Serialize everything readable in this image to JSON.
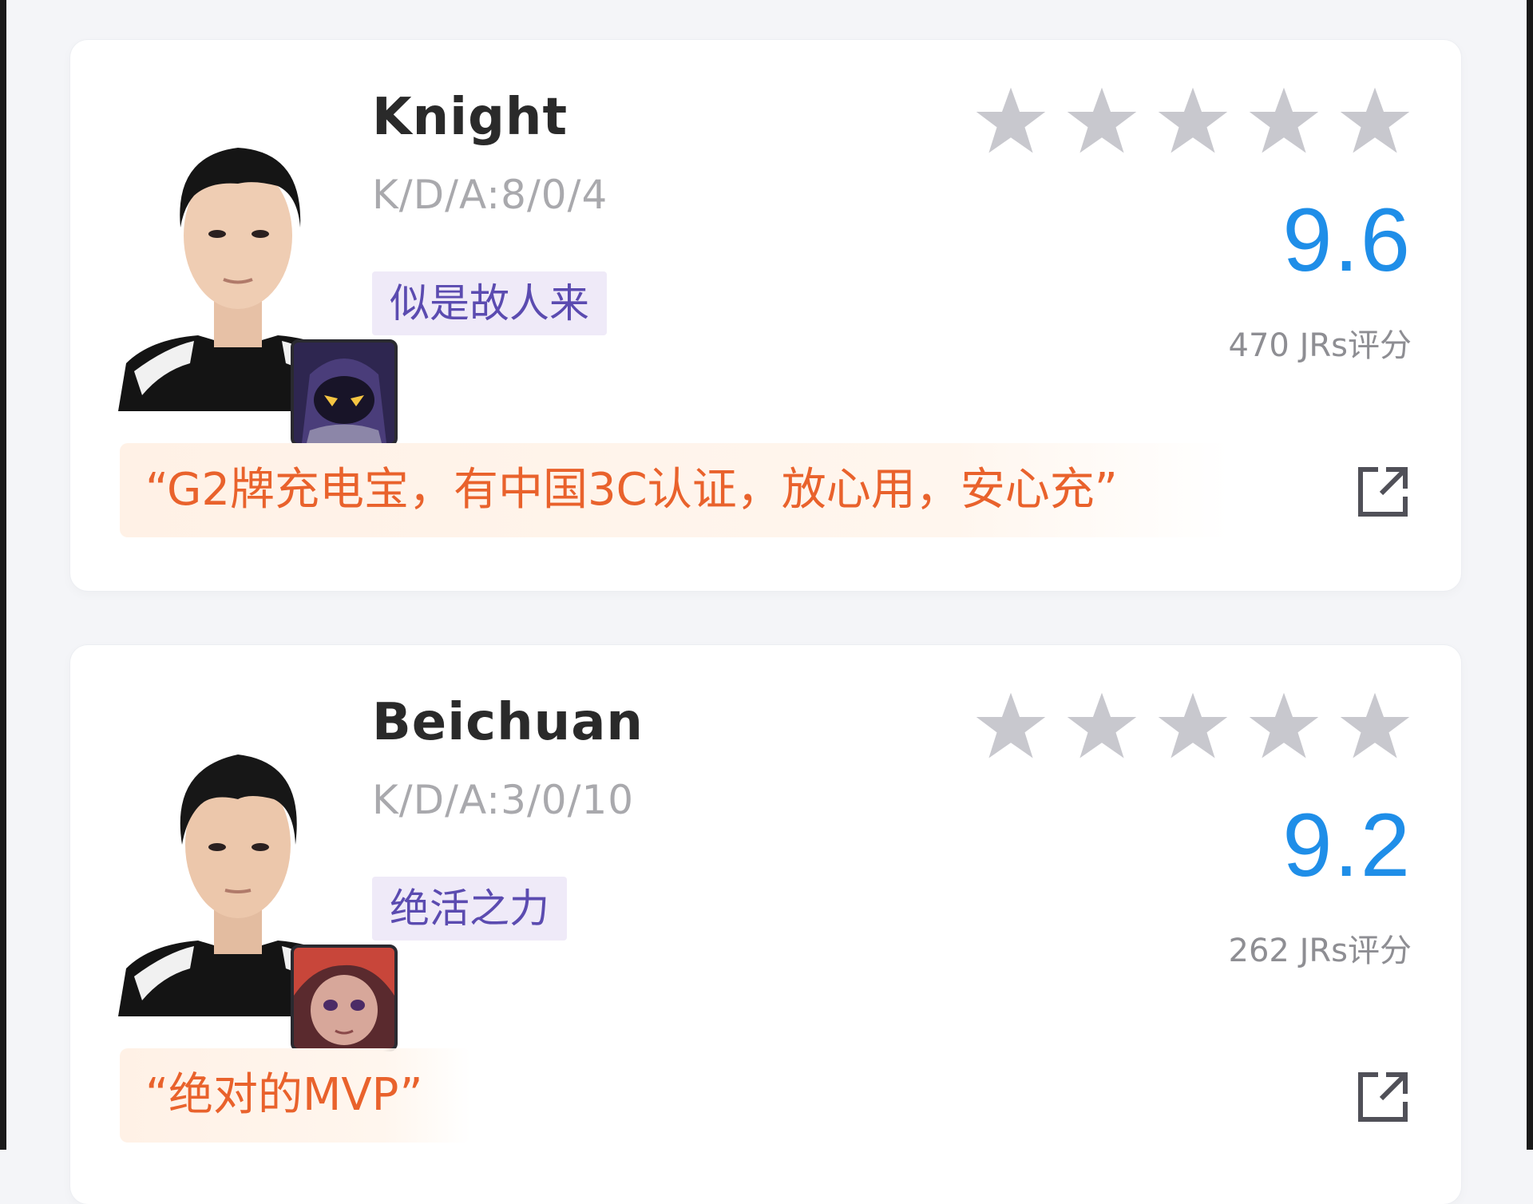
{
  "colors": {
    "score_blue": "#1f8ee8",
    "quote_orange": "#e9622c",
    "tag_purple": "#5b4bb0",
    "star_grey": "#c8c8ce",
    "kda_grey": "#a9a9ad"
  },
  "icons": {
    "star": "star-icon",
    "share": "share-external-icon"
  },
  "players": [
    {
      "name": "Knight",
      "kda": "K/D/A:8/0/4",
      "tag": "似是故人来",
      "stars_filled": 0,
      "stars_total": 5,
      "score": "9.6",
      "rating_count": "470 JRs评分",
      "quote": "“G2牌充电宝，有中国3C认证，放心用，安心充”"
    },
    {
      "name": "Beichuan",
      "kda": "K/D/A:3/0/10",
      "tag": "绝活之力",
      "stars_filled": 0,
      "stars_total": 5,
      "score": "9.2",
      "rating_count": "262 JRs评分",
      "quote": "“绝对的MVP”"
    }
  ]
}
